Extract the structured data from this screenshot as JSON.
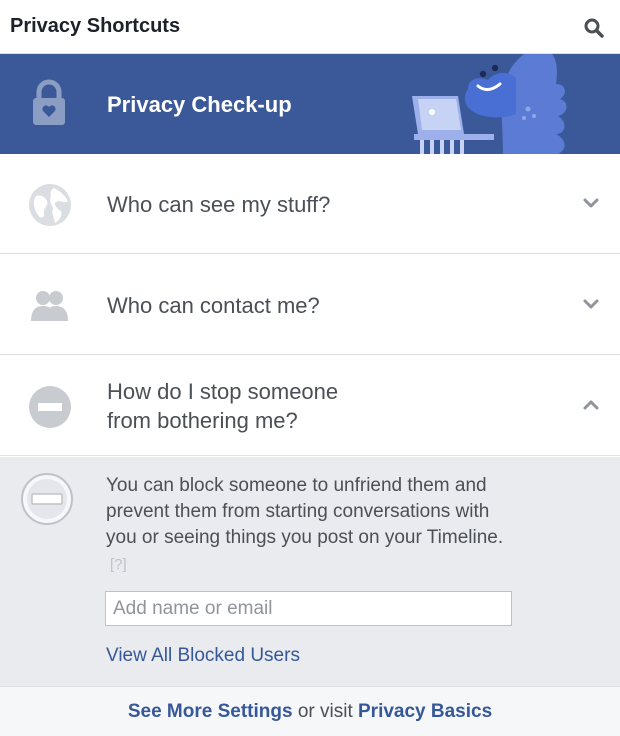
{
  "header": {
    "title": "Privacy Shortcuts",
    "search_icon": "search-icon"
  },
  "checkup": {
    "label": "Privacy Check-up",
    "icon": "lock-icon",
    "bg_color": "#3b5998"
  },
  "rows": [
    {
      "label": "Who can see my stuff?",
      "icon": "globe-icon",
      "chevron": "chevron-down-icon"
    },
    {
      "label": "Who can contact me?",
      "icon": "people-icon",
      "chevron": "chevron-down-icon"
    },
    {
      "label_line1": "How do I stop someone",
      "label_line2": "from bothering me?",
      "icon": "block-icon",
      "chevron": "chevron-up-icon"
    }
  ],
  "blocking": {
    "description": "You can block someone to unfriend them and prevent them from starting conversations with you or seeing things you post on your Timeline.",
    "help": "[?]",
    "input_placeholder": "Add name or email",
    "input_value": "",
    "view_all_link": "View All Blocked Users"
  },
  "footer": {
    "link1": "See More Settings",
    "middle": " or visit ",
    "link2": "Privacy Basics"
  }
}
